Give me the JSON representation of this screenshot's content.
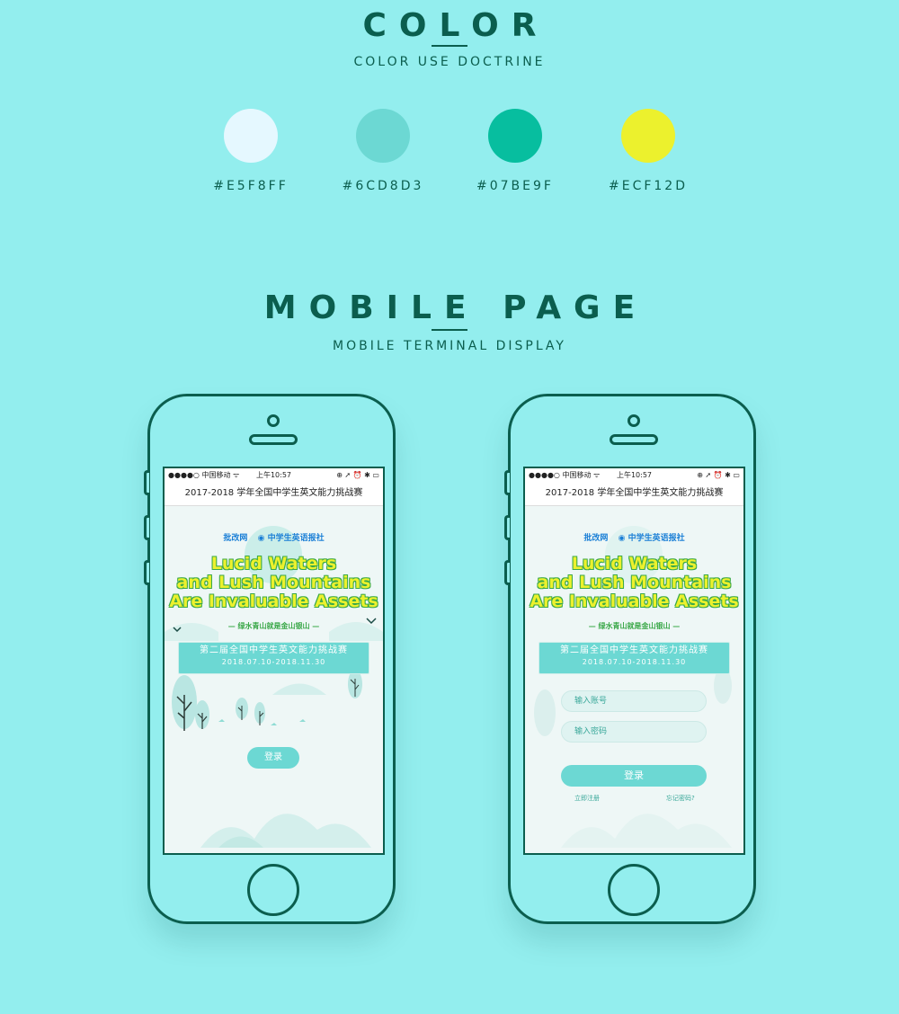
{
  "color_section": {
    "title": "COLOR",
    "subtitle": "COLOR USE DOCTRINE",
    "swatches": [
      {
        "hex": "#E5F8FF",
        "label": "#E5F8FF"
      },
      {
        "hex": "#6CD8D3",
        "label": "#6CD8D3"
      },
      {
        "hex": "#07BE9F",
        "label": "#07BE9F"
      },
      {
        "hex": "#ECF12D",
        "label": "#ECF12D"
      }
    ]
  },
  "mobile_section": {
    "title": "MOBILE PAGE",
    "subtitle": "MOBILE TERMINAL DISPLAY"
  },
  "phones": [
    {
      "status_carrier": "●●●●○ 中国移动 ᯤ",
      "status_time": "上午10:57",
      "status_icons": "⊕ ➚ ⏰ ✱ ▭",
      "nav_title": "2017-2018 学年全国中学生英文能力挑战赛",
      "logo_1": "批改网",
      "logo_2": "◉ 中学生英语报社",
      "headline_1": "Lucid Waters",
      "headline_2": "and Lush Mountains",
      "headline_3": "Are Invaluable Assets",
      "slogan": "— 绿水青山就是金山银山 —",
      "event_title": "第二届全国中学生英文能力挑战赛",
      "event_dates": "2018.07.10-2018.11.30",
      "login_label": "登录"
    },
    {
      "status_carrier": "●●●●○ 中国移动 ᯤ",
      "status_time": "上午10:57",
      "status_icons": "⊕ ➚ ⏰ ✱ ▭",
      "nav_title": "2017-2018 学年全国中学生英文能力挑战赛",
      "logo_1": "批改网",
      "logo_2": "◉ 中学生英语报社",
      "headline_1": "Lucid Waters",
      "headline_2": "and Lush Mountains",
      "headline_3": "Are Invaluable Assets",
      "slogan": "— 绿水青山就是金山银山 —",
      "event_title": "第二届全国中学生英文能力挑战赛",
      "event_dates": "2018.07.10-2018.11.30",
      "account_placeholder": "输入账号",
      "password_placeholder": "输入密码",
      "login_label": "登录",
      "register_link": "立即注册",
      "forgot_link": "忘记密码?"
    }
  ]
}
